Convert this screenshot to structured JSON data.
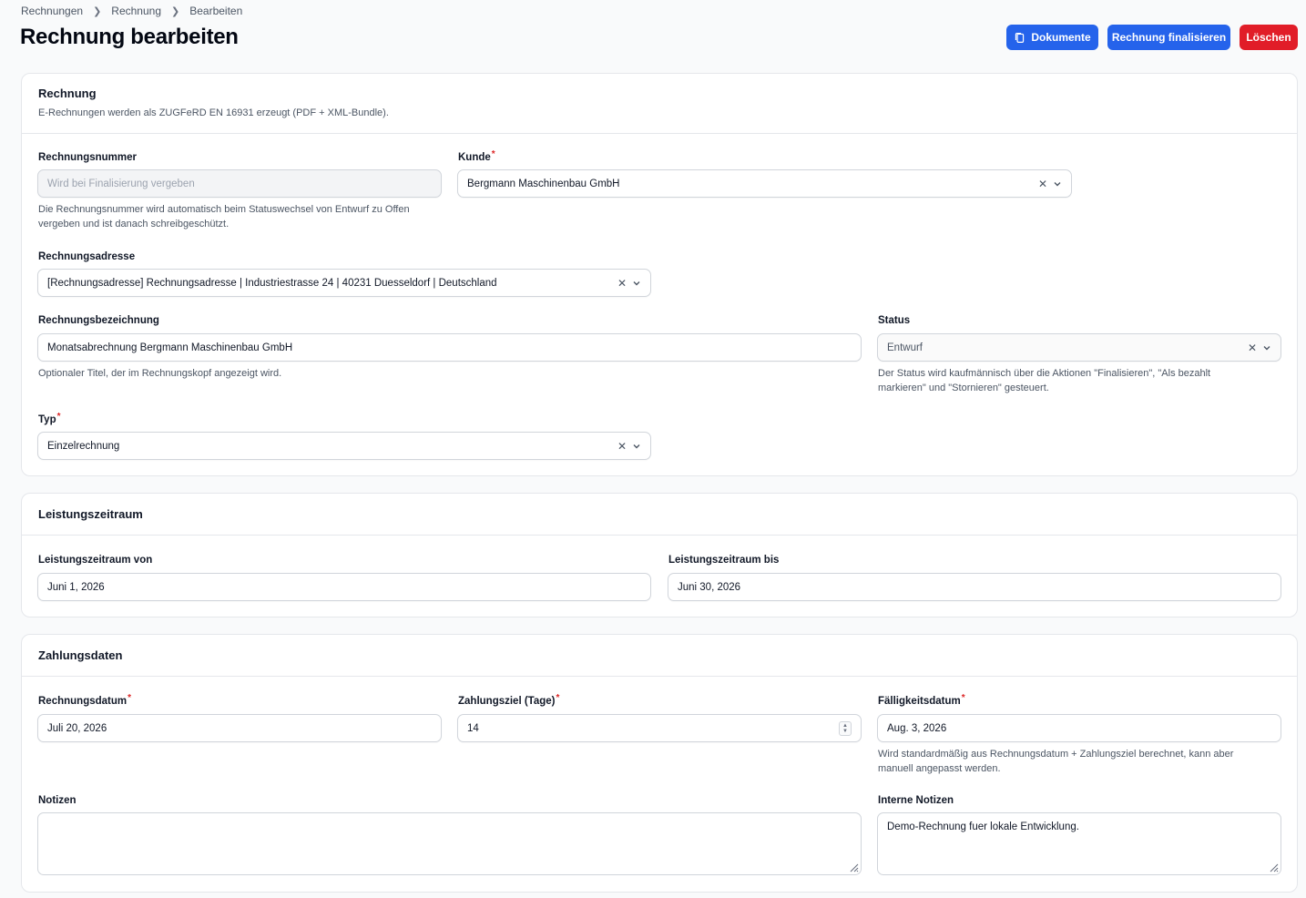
{
  "breadcrumb": [
    "Rechnungen",
    "Rechnung",
    "Bearbeiten"
  ],
  "page_title": "Rechnung bearbeiten",
  "actions": {
    "documents": "Dokumente",
    "finalize": "Rechnung finalisieren",
    "delete": "Löschen"
  },
  "section_invoice": {
    "title": "Rechnung",
    "subtitle": "E-Rechnungen werden als ZUGFeRD EN 16931 erzeugt (PDF + XML-Bundle).",
    "number_label": "Rechnungsnummer",
    "number_placeholder": "Wird bei Finalisierung vergeben",
    "number_help_1": "Die Rechnungsnummer wird automatisch beim Statuswechsel von Entwurf zu Offen",
    "number_help_2": "vergeben und ist danach schreibgeschützt.",
    "customer_label": "Kunde",
    "customer_value": "Bergmann Maschinenbau GmbH",
    "address_label": "Rechnungsadresse",
    "address_value": "[Rechnungsadresse] Rechnungsadresse | Industriestrasse 24 | 40231 Duesseldorf | Deutschland",
    "designation_label": "Rechnungsbezeichnung",
    "designation_value": "Monatsabrechnung Bergmann Maschinenbau GmbH",
    "designation_help": "Optionaler Titel, der im Rechnungskopf angezeigt wird.",
    "status_label": "Status",
    "status_value": "Entwurf",
    "status_help_1": "Der Status wird kaufmännisch über die Aktionen \"Finalisieren\", \"Als bezahlt",
    "status_help_2": "markieren\" und \"Stornieren\" gesteuert.",
    "type_label": "Typ",
    "type_value": "Einzelrechnung"
  },
  "section_period": {
    "title": "Leistungszeitraum",
    "from_label": "Leistungszeitraum von",
    "from_value": "Juni 1, 2026",
    "to_label": "Leistungszeitraum bis",
    "to_value": "Juni 30, 2026"
  },
  "section_payment": {
    "title": "Zahlungsdaten",
    "date_label": "Rechnungsdatum",
    "date_value": "Juli 20, 2026",
    "terms_label": "Zahlungsziel (Tage)",
    "terms_value": "14",
    "due_label": "Fälligkeitsdatum",
    "due_value": "Aug. 3, 2026",
    "due_help_1": "Wird standardmäßig aus Rechnungsdatum + Zahlungsziel berechnet, kann aber",
    "due_help_2": "manuell angepasst werden.",
    "notes_label": "Notizen",
    "notes_value": "",
    "internal_label": "Interne Notizen",
    "internal_value": "Demo-Rechnung fuer lokale Entwicklung."
  },
  "colors": {
    "primary": "#2563eb",
    "danger": "#e11d28",
    "required": "#dc2626"
  }
}
